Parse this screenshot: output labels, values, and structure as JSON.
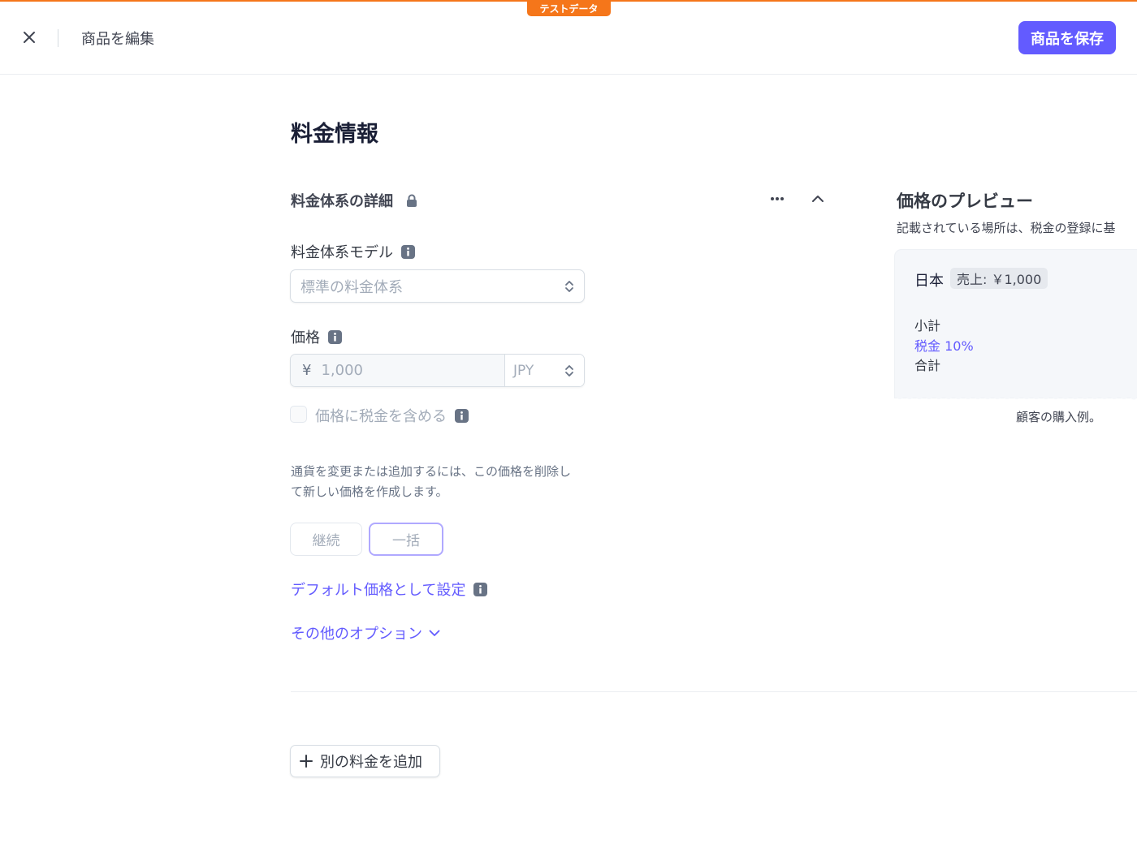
{
  "badge": {
    "test_data": "テストデータ"
  },
  "header": {
    "title": "商品を編集",
    "save_label": "商品を保存"
  },
  "page": {
    "title": "料金情報"
  },
  "pricing_details": {
    "title": "料金体系の詳細",
    "model": {
      "label": "料金体系モデル",
      "placeholder": "標準の料金体系"
    },
    "price": {
      "label": "価格",
      "currency_symbol": "¥",
      "amount_placeholder": "1,000",
      "currency": "JPY"
    },
    "include_tax_label": "価格に税金を含める",
    "helper_text": "通貨を変更または追加するには、この価格を削除して新しい価格を作成します。",
    "billing": {
      "recurring": "継続",
      "one_time": "一括"
    },
    "default_price_link": "デフォルト価格として設定",
    "more_options_link": "その他のオプション"
  },
  "add_price_label": "別の料金を追加",
  "preview": {
    "title": "価格のプレビュー",
    "subtitle": "記載されている場所は、税金の登録に基",
    "country": "日本",
    "sales_badge": "売上: ￥1,000",
    "subtotal_label": "小計",
    "tax_label": "税金 10%",
    "total_label": "合計",
    "caption": "顧客の購入例。"
  },
  "colors": {
    "accent": "#635bff",
    "test_badge": "#f5761a"
  },
  "icons": {
    "close": "close-icon",
    "lock": "lock-icon",
    "more": "more-horizontal-icon",
    "collapse": "chevron-up-icon",
    "info": "info-icon",
    "select": "chevron-up-down-icon",
    "expand": "chevron-down-icon",
    "add": "plus-icon"
  }
}
